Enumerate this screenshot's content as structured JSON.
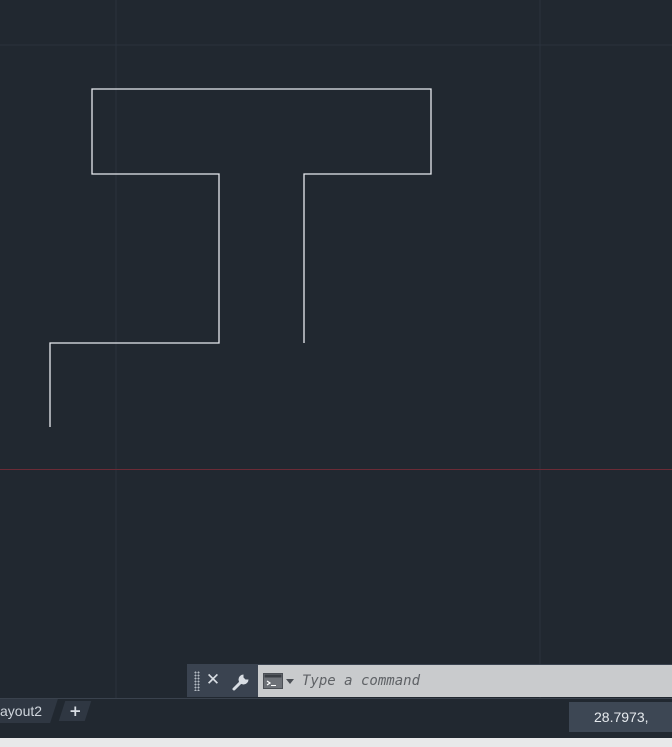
{
  "command_line": {
    "placeholder": "Type a command",
    "close_icon": "close-icon",
    "customize_icon": "wrench-icon",
    "recent_commands_icon": "command-prompt-icon"
  },
  "tabs": {
    "layout_tab_label": "ayout2",
    "add_tab_label": "+"
  },
  "status": {
    "coordinates": "28.7973,"
  },
  "colors": {
    "canvas_background": "#212830",
    "grid_line": "#2a323d",
    "x_axis": "#6b2b36",
    "geometry": "#e8ebef"
  }
}
